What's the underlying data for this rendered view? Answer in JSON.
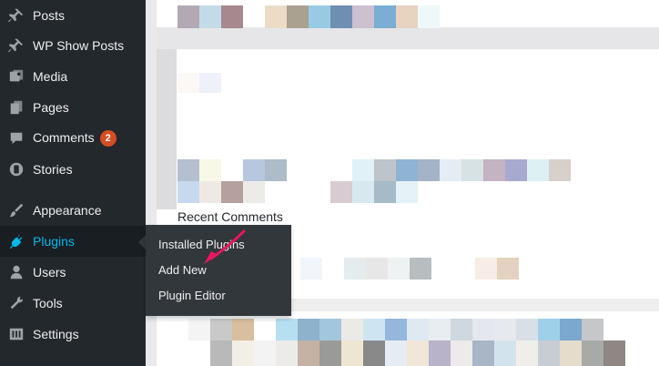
{
  "sidebar": {
    "items": [
      {
        "label": "Posts",
        "icon": "pin-icon"
      },
      {
        "label": "WP Show Posts",
        "icon": "pin-icon"
      },
      {
        "label": "Media",
        "icon": "media-icon"
      },
      {
        "label": "Pages",
        "icon": "pages-icon"
      },
      {
        "label": "Comments",
        "icon": "comment-icon",
        "badge": "2"
      },
      {
        "label": "Stories",
        "icon": "stories-icon"
      },
      {
        "label": "Appearance",
        "icon": "brush-icon"
      },
      {
        "label": "Plugins",
        "icon": "plugin-icon",
        "active": true
      },
      {
        "label": "Users",
        "icon": "user-icon"
      },
      {
        "label": "Tools",
        "icon": "wrench-icon"
      },
      {
        "label": "Settings",
        "icon": "settings-icon"
      }
    ]
  },
  "plugins_submenu": {
    "items": [
      "Installed Plugins",
      "Add New",
      "Plugin Editor"
    ]
  },
  "dashboard": {
    "recent_comments_title": "Recent Comments"
  },
  "colors": {
    "sidebar_bg": "#23282d",
    "submenu_bg": "#32373c",
    "active_text": "#00b9eb",
    "badge_bg": "#d54e21",
    "pointer_arrow": "#e8175d"
  }
}
